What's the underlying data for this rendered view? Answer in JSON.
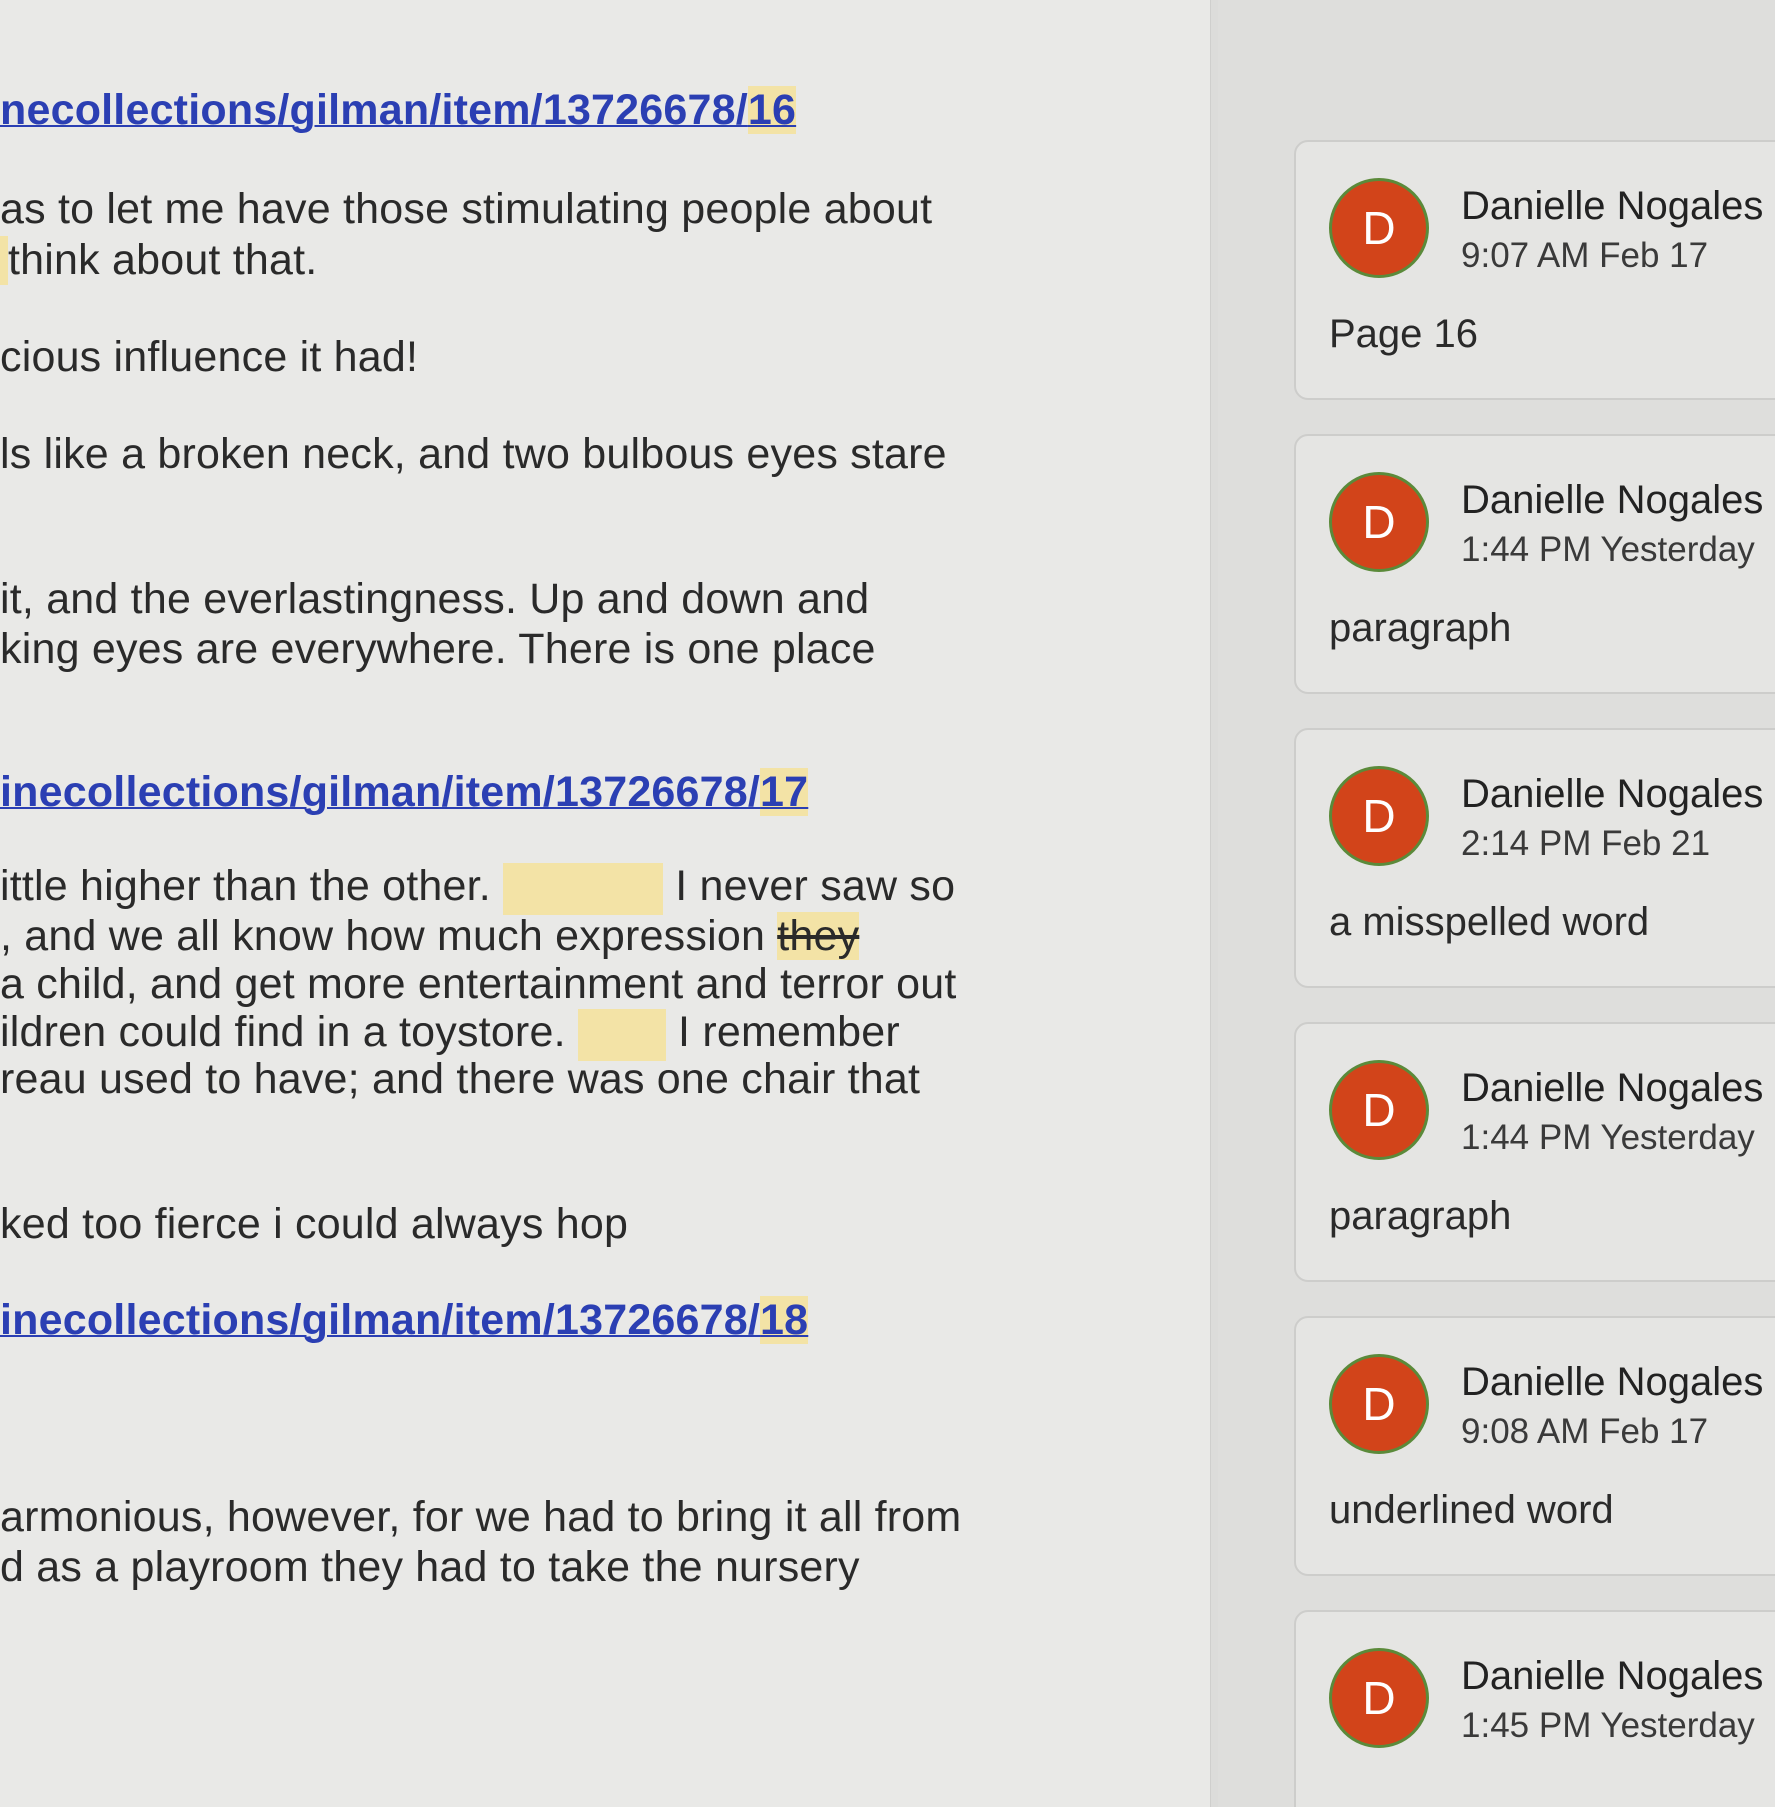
{
  "document": {
    "link_16": {
      "text": "necollections/gilman/item/13726678/",
      "page": "16"
    },
    "p1_l1": "as to let me have those stimulating people about",
    "p1_l2": "think about that.",
    "p2_l1": "cious influence it had!",
    "p3_l1": "ls like a broken neck, and two bulbous eyes stare",
    "p4_l1": "it, and the everlastingness. Up and down and",
    "p4_l2": "king eyes are everywhere. There is one place",
    "link_17": {
      "text": "inecollections/gilman/item/13726678/",
      "page": "17"
    },
    "p5_l1a": "ittle higher than the other.",
    "p5_l1b": "I never saw so",
    "p5_l2a": ", and we all know how much expression",
    "p5_l2b": "they",
    "p5_l3": "a child, and get more entertainment and terror out",
    "p5_l4a": "ildren could find in a toystore.",
    "p5_l4b": "I remember",
    "p5_l5": "reau used to have; and there was one chair that",
    "p6_l1": "ked too fierce i could always hop",
    "link_18": {
      "text": "inecollections/gilman/item/13726678/",
      "page": "18"
    },
    "p7_l1": "armonious, however, for we had to bring it all from",
    "p7_l2": "d as a playroom they had to take the nursery"
  },
  "comments": [
    {
      "initial": "D",
      "author": "Danielle Nogales",
      "time": "9:07 AM Feb 17",
      "text": "Page 16"
    },
    {
      "initial": "D",
      "author": "Danielle Nogales",
      "time": "1:44 PM Yesterday",
      "text": "paragraph"
    },
    {
      "initial": "D",
      "author": "Danielle Nogales",
      "time": "2:14 PM Feb 21",
      "text": "a misspelled word"
    },
    {
      "initial": "D",
      "author": "Danielle Nogales",
      "time": "1:44 PM Yesterday",
      "text": "paragraph"
    },
    {
      "initial": "D",
      "author": "Danielle Nogales",
      "time": "9:08 AM Feb 17",
      "text": "underlined word"
    },
    {
      "initial": "D",
      "author": "Danielle Nogales",
      "time": "1:45 PM Yesterday",
      "text": ""
    }
  ],
  "colors": {
    "avatar": "#d2441a",
    "link": "#2b3fb3",
    "highlight": "#f3e3a6"
  }
}
